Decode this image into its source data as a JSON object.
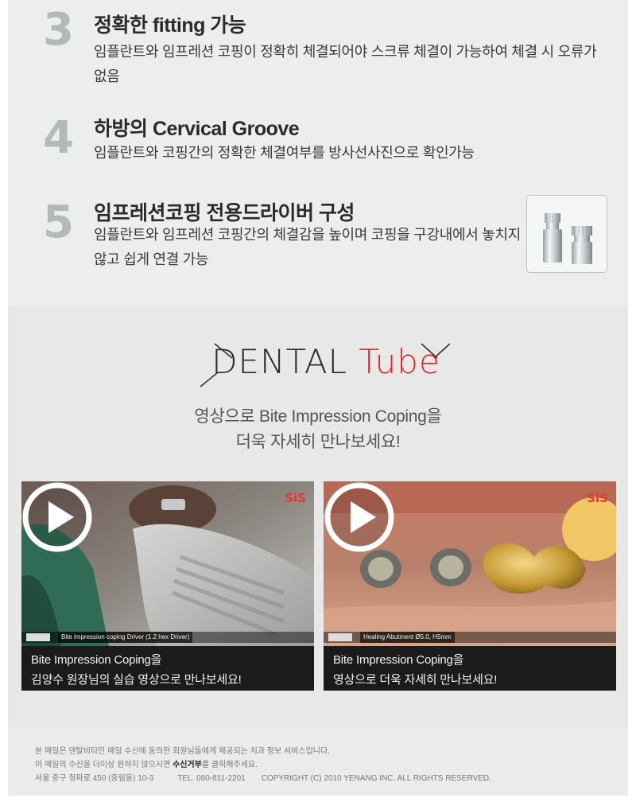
{
  "features": [
    {
      "number": "3",
      "title": "정확한 fitting 가능",
      "desc": "임플란트와 임프레션 코핑이 정확히 체결되어야 스크류 체결이 가능하여 체결 시 오류가 없음"
    },
    {
      "number": "4",
      "title": "하방의 Cervical Groove",
      "desc": "임플란트와 코핑간의 정확한 체결여부를 방사선사진으로 확인가능"
    },
    {
      "number": "5",
      "title": "임프레션코핑 전용드라이버 구성",
      "desc": "임플란트와 임프레션 코핑간의 체결감을 높이며 코핑을 구강내에서 놓치지 않고 쉽게 연결 가능"
    }
  ],
  "tube": {
    "brand_word1": "DENTAL",
    "brand_word2": "Tube",
    "intro_line1": "영상으로 Bite Impression Coping을",
    "intro_line2": "더욱 자세히 만나보세요!"
  },
  "videos": [
    {
      "badge": "SiS",
      "frame_caption": "Bite impression coping Driver (1.2 hex Driver)",
      "title_line1": "Bite Impression Coping을",
      "title_line2": "김양수 원장님의 실습 영상으로 만나보세요!"
    },
    {
      "badge": "SiS",
      "frame_caption": "Healing Abutment Ø5.0, H5mm",
      "title_line1": "Bite Impression Coping을",
      "title_line2": "영상으로 더욱 자세히 만나보세요!"
    }
  ],
  "footer": {
    "line1": "본 메일은 덴탈비타민 메일 수신에 동의한 회원님들에게 제공되는 치과 정보 서비스입니다.",
    "line2_prefix": "이 메일의 수신을 더이상 원하지 않으시면 ",
    "line2_link": "수신거부",
    "line2_suffix": "를 클릭해주세요.",
    "address": "서울 중구 청파로 450 (중림동) 10-3",
    "tel": "TEL. 080-811-2201",
    "copyright": "COPYRIGHT (C) 2010 YENANG INC. ALL RIGHTS RESERVED."
  },
  "colors": {
    "accent_red": "#e0252a",
    "feature_number": "#b4b9b7",
    "panel_bg": "#ebeeed"
  }
}
